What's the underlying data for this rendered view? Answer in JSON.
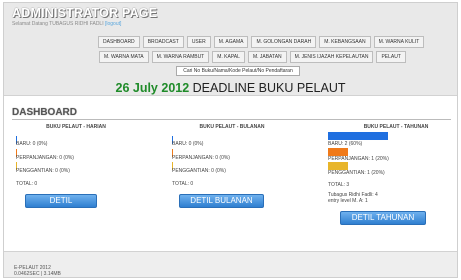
{
  "header": {
    "title": "ADMINISTRATOR PAGE",
    "welcome_prefix": "Selamat Datang TUBAGUS RIDHI FADLI",
    "welcome_link": "[logout]"
  },
  "nav_row1": [
    "DASHBOARD",
    "BROADCAST",
    "USER",
    "M. AGAMA",
    "M. GOLONGAN DARAH",
    "M. KEBANGSAAN",
    "M. WARNA KULIT"
  ],
  "nav_row2": [
    "M. WARNA MATA",
    "M. WARNA RAMBUT",
    "M. KAPAL",
    "M. JABATAN",
    "M. JENIS IJAZAH KEPELAUTAN",
    "PELAUT"
  ],
  "search": {
    "placeholder": "Cari No Buku/Nama/Kode Pelaut/No Pendaftaran"
  },
  "deadline": {
    "date": "26 July 2012",
    "text": "DEADLINE BUKU PELAUT"
  },
  "dashboard": {
    "title": "DASHBOARD",
    "columns": [
      {
        "title": "BUKU PELAUT - HARIAN",
        "baru": "BARU: 0 (0%)",
        "perpanjangan": "PERPANJANGAN: 0 (0%)",
        "pengganti": "PENGGANTIAN: 0 (0%)",
        "total": "TOTAL: 0",
        "button": "DETIL"
      },
      {
        "title": "BUKU PELAUT - BULANAN",
        "baru": "BARU: 0 (0%)",
        "perpanjangan": "PERPANJANGAN: 0 (0%)",
        "pengganti": "PENGGANTIAN: 0 (0%)",
        "total": "TOTAL: 0",
        "button": "DETIL BULANAN"
      },
      {
        "title": "BUKU PELAUT - TAHUNAN",
        "baru": "BARU: 2 (60%)",
        "perpanjangan": "PERPANJANGAN: 1 (20%)",
        "pengganti": "PENGGANTIAN: 1 (20%)",
        "total": "TOTAL: 3",
        "note1": "Tubagus Ridhi Fadli: 4",
        "note2": "entry level M. A: 1",
        "button": "DETIL TAHUNAN"
      }
    ]
  },
  "footer": {
    "line1": "E-PELAUT 2012",
    "line2": "0.0462SEC | 3.14MB"
  },
  "colors": {
    "bar_blue": "#1f6fe0",
    "bar_orange": "#f07a1a",
    "bar_yellow": "#e8b52a",
    "date_green": "#1f8b29"
  }
}
